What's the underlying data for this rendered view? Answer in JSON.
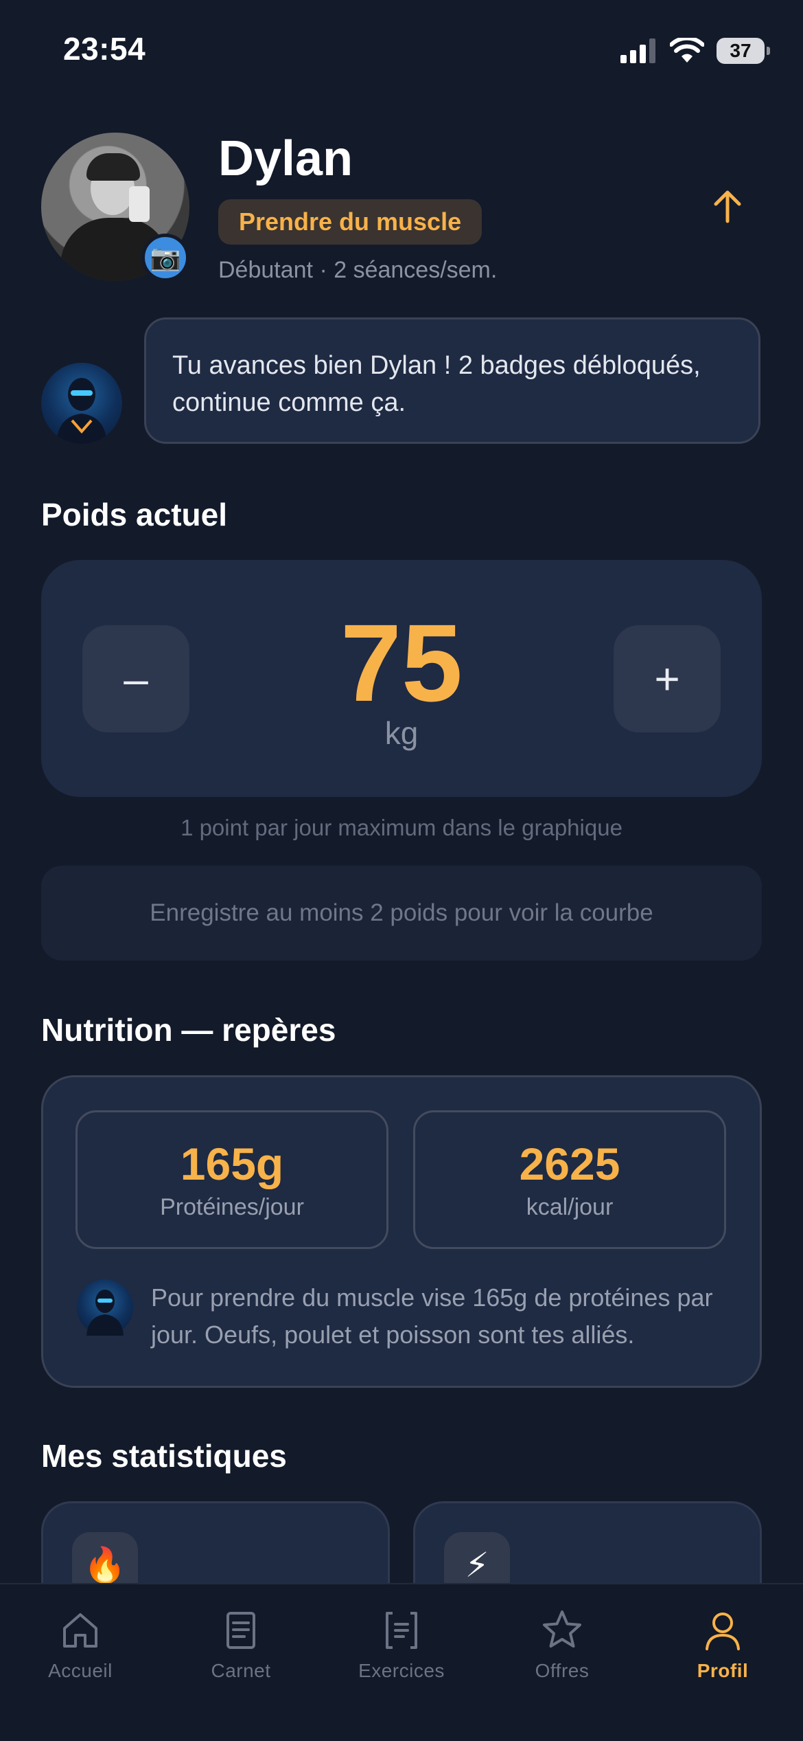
{
  "status_bar": {
    "time": "23:54",
    "battery": "37"
  },
  "profile": {
    "name": "Dylan",
    "goal": "Prendre du muscle",
    "subline": "Débutant · 2 séances/sem."
  },
  "coach_message": "Tu avances bien Dylan ! 2 badges débloqués, continue comme ça.",
  "weight": {
    "title": "Poids actuel",
    "value": "75",
    "unit": "kg",
    "minus_label": "–",
    "plus_label": "+",
    "hint": "1 point par jour maximum dans le graphique",
    "empty_chart": "Enregistre au moins 2 poids pour voir la courbe"
  },
  "nutrition": {
    "title": "Nutrition — repères",
    "protein_value": "165g",
    "protein_label": "Protéines/jour",
    "kcal_value": "2625",
    "kcal_label": "kcal/jour",
    "tip": "Pour prendre du muscle vise 165g de protéines par jour. Oeufs, poulet et poisson sont tes alliés."
  },
  "stats": {
    "title": "Mes statistiques",
    "cards": [
      {
        "icon": "🔥",
        "icon_name": "fire-icon"
      },
      {
        "icon": "⚡",
        "icon_name": "lightning-icon"
      }
    ]
  },
  "tabs": [
    {
      "label": "Accueil",
      "icon": "home-icon",
      "active": false
    },
    {
      "label": "Carnet",
      "icon": "notebook-icon",
      "active": false
    },
    {
      "label": "Exercices",
      "icon": "exercises-icon",
      "active": false
    },
    {
      "label": "Offres",
      "icon": "star-icon",
      "active": false
    },
    {
      "label": "Profil",
      "icon": "user-icon",
      "active": true
    }
  ],
  "colors": {
    "background": "#131a2a",
    "card": "#1f2a43",
    "accent": "#f7b24a",
    "muted_text": "#8b93a3"
  }
}
